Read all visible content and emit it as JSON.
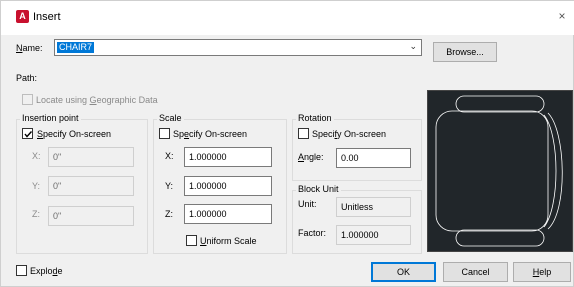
{
  "window": {
    "title": "Insert",
    "close_glyph": "×",
    "app_icon_letter": "A"
  },
  "name": {
    "label": "Name:",
    "value": "CHAIR7",
    "browse_label": "Browse..."
  },
  "path": {
    "label": "Path:"
  },
  "geo": {
    "label": "Locate using Geographic Data"
  },
  "insertion": {
    "title": "Insertion point",
    "specify_label": "Specify On-screen",
    "specify_checked": true,
    "x_label": "X:",
    "x_value": "0\"",
    "y_label": "Y:",
    "y_value": "0\"",
    "z_label": "Z:",
    "z_value": "0\""
  },
  "scale": {
    "title": "Scale",
    "specify_label": "Specify On-screen",
    "x_label": "X:",
    "x_value": "1.000000",
    "y_label": "Y:",
    "y_value": "1.000000",
    "z_label": "Z:",
    "z_value": "1.000000",
    "uniform_label": "Uniform Scale"
  },
  "rotation": {
    "title": "Rotation",
    "specify_label": "Specify On-screen",
    "angle_label": "Angle:",
    "angle_value": "0.00"
  },
  "block_unit": {
    "title": "Block Unit",
    "unit_label": "Unit:",
    "unit_value": "Unitless",
    "factor_label": "Factor:",
    "factor_value": "1.000000"
  },
  "explode": {
    "label": "Explode"
  },
  "buttons": {
    "ok": "OK",
    "cancel": "Cancel",
    "help": "Help"
  },
  "colors": {
    "accent": "#0078d7",
    "preview_bg": "#21262a",
    "preview_stroke": "#ffffff"
  },
  "icons": {
    "combo_arrow": "chevron-down-icon",
    "check": "checkmark-icon"
  }
}
